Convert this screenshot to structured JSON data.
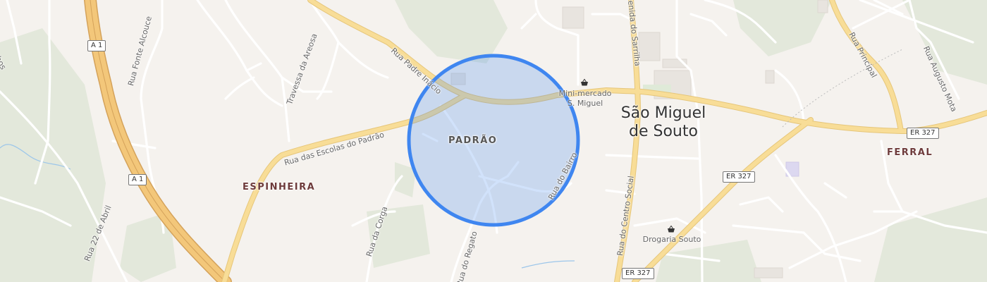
{
  "map": {
    "highlight_color": "#3f86f0",
    "highlight_fill": "#c9d9f5",
    "road_major_color": "#f6d98f",
    "road_minor_color": "#ffffff",
    "green_color": "#e3e8db",
    "water_color": "#9cc6ea"
  },
  "places": {
    "town_line1": "São Miguel",
    "town_line2": "de Souto",
    "padrao": "PADRÃO",
    "espinheira": "ESPINHEIRA",
    "ferral": "FERRAL"
  },
  "streets": {
    "rua_padre_inacio": "Rua Padre Inácio",
    "rua_fonte_alcouce": "Rua Fonte Alcouce",
    "travessa_da_areosa": "Travessa da Areosa",
    "rua_das_escolas": "Rua das Escolas do Padrão",
    "rua_22_abril": "Rua 22 de Abril",
    "rua_da_corga": "Rua da Corga",
    "rua_do_regato": "Rua do Regato",
    "rua_do_bairro": "Rua do Bairro",
    "avenida_sarrilha": "enida do Sarrilha",
    "rua_centro_social": "Rua do Centro Social",
    "rua_principal": "Rua Principal",
    "rua_augusto_mota": "Rua Augusto Mota",
    "partial_left": "nhos"
  },
  "shields": {
    "a1_top": "A 1",
    "a1_mid": "A 1",
    "er327_right": "ER 327",
    "er327_mid": "ER 327",
    "er327_bottom": "ER 327"
  },
  "pois": {
    "minimercado_line1": "Mini-mercado",
    "minimercado_line2": "S. Miguel",
    "drogaria": "Drogaria Souto"
  },
  "icons": {
    "shop": "shopping-basket-icon",
    "pharmacy": "shopping-basket-icon"
  }
}
